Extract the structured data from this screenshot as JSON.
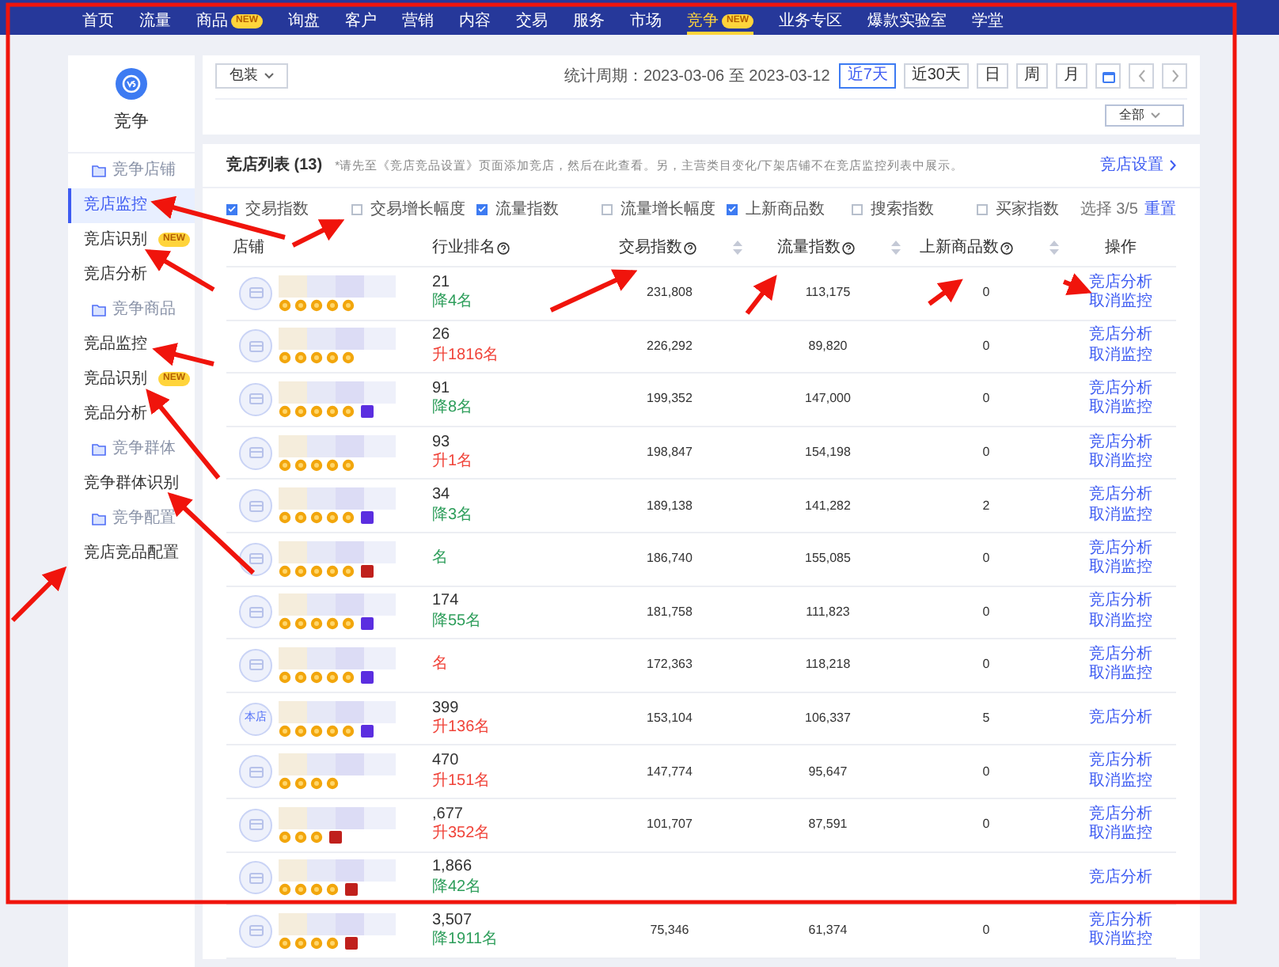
{
  "nav": [
    {
      "label": "首页",
      "selected": false
    },
    {
      "label": "流量",
      "selected": false
    },
    {
      "label": "商品",
      "badge": "NEW",
      "selected": false
    },
    {
      "label": "询盘",
      "selected": false
    },
    {
      "label": "客户",
      "selected": false
    },
    {
      "label": "营销",
      "selected": false
    },
    {
      "label": "内容",
      "selected": false
    },
    {
      "label": "交易",
      "selected": false
    },
    {
      "label": "服务",
      "selected": false
    },
    {
      "label": "市场",
      "selected": false
    },
    {
      "label": "竞争",
      "badge": "NEW",
      "selected": true
    },
    {
      "label": "业务专区",
      "selected": false
    },
    {
      "label": "爆款实验室",
      "selected": false
    },
    {
      "label": "学堂",
      "selected": false
    }
  ],
  "sidebar": {
    "title": "竞争",
    "items": [
      {
        "kind": "section",
        "label": "竞争店铺"
      },
      {
        "kind": "item",
        "label": "竞店监控",
        "selected": true
      },
      {
        "kind": "item",
        "label": "竞店识别",
        "badge": "NEW",
        "selected": false
      },
      {
        "kind": "item",
        "label": "竞店分析",
        "selected": false
      },
      {
        "kind": "section",
        "label": "竞争商品"
      },
      {
        "kind": "item",
        "label": "竞品监控",
        "selected": false
      },
      {
        "kind": "item",
        "label": "竞品识别",
        "badge": "NEW",
        "selected": false
      },
      {
        "kind": "item",
        "label": "竞品分析",
        "selected": false
      },
      {
        "kind": "section",
        "label": "竞争群体"
      },
      {
        "kind": "item",
        "label": "竞争群体识别",
        "selected": false
      },
      {
        "kind": "section",
        "label": "竞争配置"
      },
      {
        "kind": "item",
        "label": "竞店竞品配置",
        "selected": false
      }
    ]
  },
  "filters": {
    "category": "包装",
    "period_label": "统计周期：2023-03-06 至 2023-03-12",
    "ranges": [
      {
        "label": "近7天",
        "selected": true
      },
      {
        "label": "近30天",
        "selected": false
      },
      {
        "label": "日",
        "selected": false
      },
      {
        "label": "周",
        "selected": false
      },
      {
        "label": "月",
        "selected": false
      }
    ],
    "scope": "全部"
  },
  "list": {
    "title": "竞店列表 (13)",
    "note": "*请先至《竞店竞品设置》页面添加竞店，然后在此查看。另，主营类目变化/下架店铺不在竞店监控列表中展示。",
    "settings_link": "竞店设置",
    "checks": [
      {
        "label": "交易指数",
        "checked": true
      },
      {
        "label": "交易增长幅度",
        "checked": false
      },
      {
        "label": "流量指数",
        "checked": true
      },
      {
        "label": "流量增长幅度",
        "checked": false
      },
      {
        "label": "上新商品数",
        "checked": true
      },
      {
        "label": "搜索指数",
        "checked": false
      },
      {
        "label": "买家指数",
        "checked": false
      }
    ],
    "selection": "选择 3/5",
    "reset": "重置",
    "columns": [
      "店铺",
      "行业排名",
      "交易指数",
      "流量指数",
      "上新商品数",
      "操作"
    ],
    "rows": [
      {
        "stars": 5,
        "rank": "21",
        "change": "降4名",
        "kind": "down",
        "trade": "231,808",
        "traffic": "113,175",
        "new_items": "0",
        "actions": [
          "竞店分析",
          "取消监控"
        ]
      },
      {
        "stars": 5,
        "rank": "26",
        "change": "升1816名",
        "kind": "up",
        "trade": "226,292",
        "traffic": "89,820",
        "new_items": "0",
        "actions": [
          "竞店分析",
          "取消监控"
        ]
      },
      {
        "stars": 5,
        "color": "#5b2ee0",
        "rank": "91",
        "change": "降8名",
        "kind": "down",
        "trade": "199,352",
        "traffic": "147,000",
        "new_items": "0",
        "actions": [
          "竞店分析",
          "取消监控"
        ]
      },
      {
        "stars": 5,
        "rank": "93",
        "change": "升1名",
        "kind": "up",
        "trade": "198,847",
        "traffic": "154,198",
        "new_items": "0",
        "actions": [
          "竞店分析",
          "取消监控"
        ]
      },
      {
        "stars": 5,
        "color": "#5b2ee0",
        "rank": "34",
        "change": "降3名",
        "kind": "down",
        "trade": "189,138",
        "traffic": "141,282",
        "new_items": "2",
        "actions": [
          "竞店分析",
          "取消监控"
        ]
      },
      {
        "stars": 5,
        "color": "#c0201c",
        "change": "名",
        "kind": "down",
        "trade": "186,740",
        "traffic": "155,085",
        "new_items": "0",
        "actions": [
          "竞店分析",
          "取消监控"
        ]
      },
      {
        "stars": 5,
        "color": "#5b2ee0",
        "rank": "174",
        "change": "降55名",
        "kind": "down",
        "trade": "181,758",
        "traffic": "111,823",
        "new_items": "0",
        "actions": [
          "竞店分析",
          "取消监控"
        ]
      },
      {
        "stars": 5,
        "color": "#5b2ee0",
        "change": "名",
        "kind": "up",
        "trade": "172,363",
        "traffic": "118,218",
        "new_items": "0",
        "actions": [
          "竞店分析",
          "取消监控"
        ]
      },
      {
        "stars": 5,
        "color": "#5b2ee0",
        "avatar": "本店",
        "rank": "399",
        "change": "升136名",
        "kind": "up",
        "trade": "153,104",
        "traffic": "106,337",
        "new_items": "5",
        "actions": [
          "竞店分析"
        ]
      },
      {
        "stars": 4,
        "rank": "470",
        "change": "升151名",
        "kind": "up",
        "trade": "147,774",
        "traffic": "95,647",
        "new_items": "0",
        "actions": [
          "竞店分析",
          "取消监控"
        ]
      },
      {
        "stars": 3,
        "color": "#c0201c",
        "rank": ",677",
        "change": "升352名",
        "kind": "up",
        "trade": "101,707",
        "traffic": "87,591",
        "new_items": "0",
        "actions": [
          "竞店分析",
          "取消监控"
        ]
      },
      {
        "stars": 4,
        "color": "#c0201c",
        "rank": "1,866",
        "change": "降42名",
        "kind": "down",
        "actions": [
          "竞店分析"
        ]
      },
      {
        "stars": 4,
        "color": "#c0201c",
        "rank": "3,507",
        "change": "降1911名",
        "kind": "down",
        "trade": "75,346",
        "traffic": "61,374",
        "new_items": "0",
        "actions": [
          "竞店分析",
          "取消监控"
        ]
      }
    ]
  }
}
